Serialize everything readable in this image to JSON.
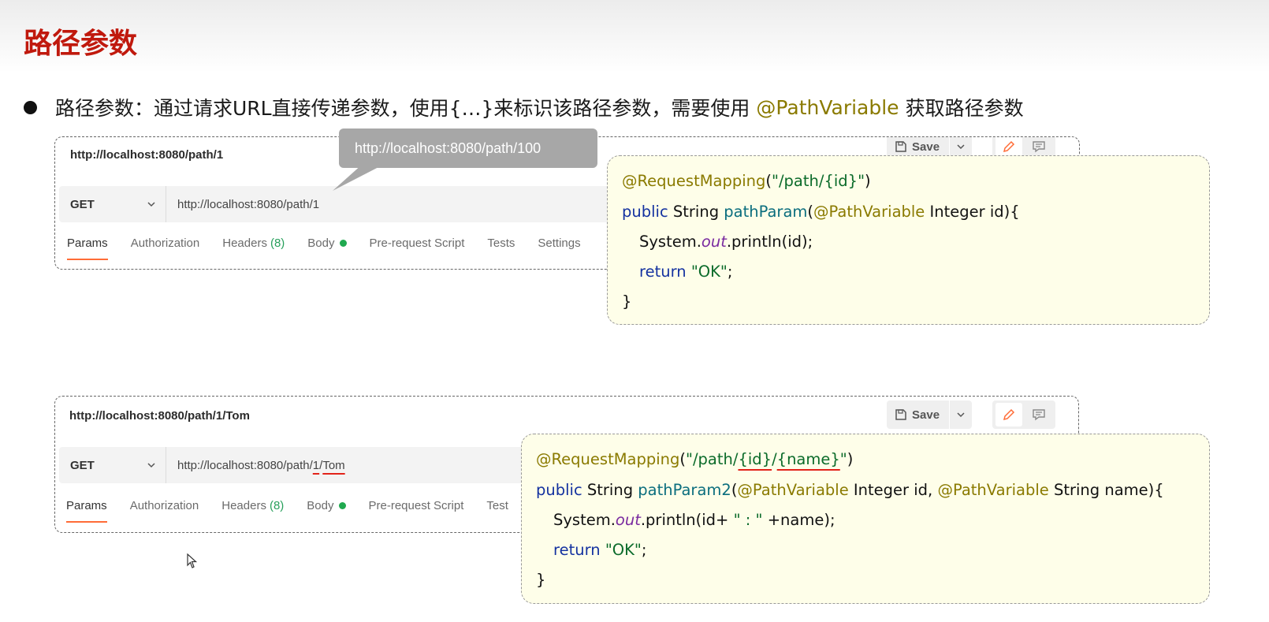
{
  "slide": {
    "title": "路径参数",
    "bullet": {
      "prefix": "路径参数：通过请求URL直接传递参数，使用{…}来标识该路径参数，需要使用",
      "annotation": "@PathVariable",
      "suffix": "获取路径参数"
    }
  },
  "tooltip": {
    "text": "http://localhost:8080/path/100"
  },
  "panel1": {
    "request_title": "http://localhost:8080/path/1",
    "save_label": "Save",
    "method": "GET",
    "url": "http://localhost:8080/path/1",
    "tabs": {
      "params": "Params",
      "authorization": "Authorization",
      "headers": "Headers",
      "headers_count": "(8)",
      "body": "Body",
      "prerequest": "Pre-request Script",
      "tests": "Tests",
      "settings": "Settings"
    }
  },
  "panel2": {
    "request_title": "http://localhost:8080/path/1/Tom",
    "save_label": "Save",
    "method": "GET",
    "url_base": "http://localhost:8080/path/",
    "url_id": "1",
    "url_slash": "/",
    "url_name": "Tom",
    "tabs": {
      "params": "Params",
      "authorization": "Authorization",
      "headers": "Headers",
      "headers_count": "(8)",
      "body": "Body",
      "prerequest": "Pre-request Script",
      "tests": "Test"
    }
  },
  "code1": {
    "l1_anno": "@RequestMapping",
    "l1_open": "(",
    "l1_str": "\"/path/{id}\"",
    "l1_close": ")",
    "l2_kw": "public",
    "l2_type": " String ",
    "l2_method": "pathParam",
    "l2_open": "(",
    "l2_anno": "@PathVariable",
    "l2_rest": " Integer id){",
    "l3_a": "System.",
    "l3_field": "out",
    "l3_b": ".println(id);",
    "l4_kw": "return",
    "l4_str": " \"OK\"",
    "l4_end": ";",
    "l5": "}"
  },
  "code2": {
    "l1_anno": "@RequestMapping",
    "l1_open": "(",
    "l1_str_a": "\"/path/",
    "l1_str_id": "{id}",
    "l1_str_slash": "/",
    "l1_str_name": "{name}",
    "l1_str_b": "\"",
    "l1_close": ")",
    "l2_kw": "public",
    "l2_type": " String ",
    "l2_method": "pathParam2",
    "l2_open": "(",
    "l2_anno1": "@PathVariable",
    "l2_mid": " Integer id, ",
    "l2_anno2": "@PathVariable",
    "l2_rest": " String name){",
    "l3_a": "System.",
    "l3_field": "out",
    "l3_b": ".println(id+",
    "l3_str": " \" : \" ",
    "l3_c": "+name);",
    "l4_kw": "return",
    "l4_str": " \"OK\"",
    "l4_end": ";",
    "l5": "}"
  },
  "colors": {
    "title_red": "#c0190d",
    "annotation_olive": "#8a7a00",
    "string_green": "#0b6b2a",
    "keyword_blue": "#1432a0",
    "postman_orange": "#ff6c37",
    "code_bg": "#fefee9"
  }
}
